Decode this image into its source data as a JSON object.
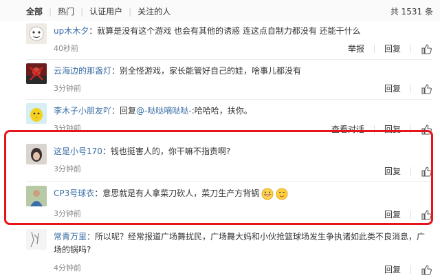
{
  "filter": {
    "tabs": [
      "全部",
      "热门",
      "认证用户",
      "关注的人"
    ],
    "total": "共 1531 条"
  },
  "comments": [
    {
      "user": "up木木夕",
      "text": "：就算是没有这个游戏 也会有其他的诱惑 连这点自制力都没有 还能干什么",
      "time": "40秒前",
      "actions": [
        "举报",
        "回复"
      ]
    },
    {
      "user": "云海边的那盏灯",
      "text": "：别全怪游戏，家长能管好自己的娃，啥事儿都没有",
      "time": "3分钟前",
      "actions": [
        "回复"
      ]
    },
    {
      "user": "李木子小朋友吖",
      "reply_prefix": "：回复",
      "reply_to": "@-哒哒嘀哒哒-",
      "text": ":哈哈哈，扶你。",
      "time": "3分钟前",
      "actions": [
        "查看对话",
        "回复"
      ]
    },
    {
      "user": "这是小号170",
      "text": "：钱也挺害人的，你干嘛不指责啊?",
      "time": "3分钟前",
      "actions": [
        "回复"
      ]
    },
    {
      "user": "CP3号球衣",
      "text": "：意思就是有人拿菜刀砍人，菜刀生产方背锅",
      "time": "3分钟前",
      "actions": [
        "回复"
      ]
    },
    {
      "user": "常青万里",
      "text": "：所以呢？经常报道广场舞扰民，广场舞大妈和小伙抢篮球场发生争执诸如此类不良消息，广场的锅吗?",
      "time": "4分钟前",
      "actions": [
        "回复"
      ]
    }
  ],
  "colors": {
    "link": "#3a6ea5",
    "highlight_border": "#e8141b"
  }
}
